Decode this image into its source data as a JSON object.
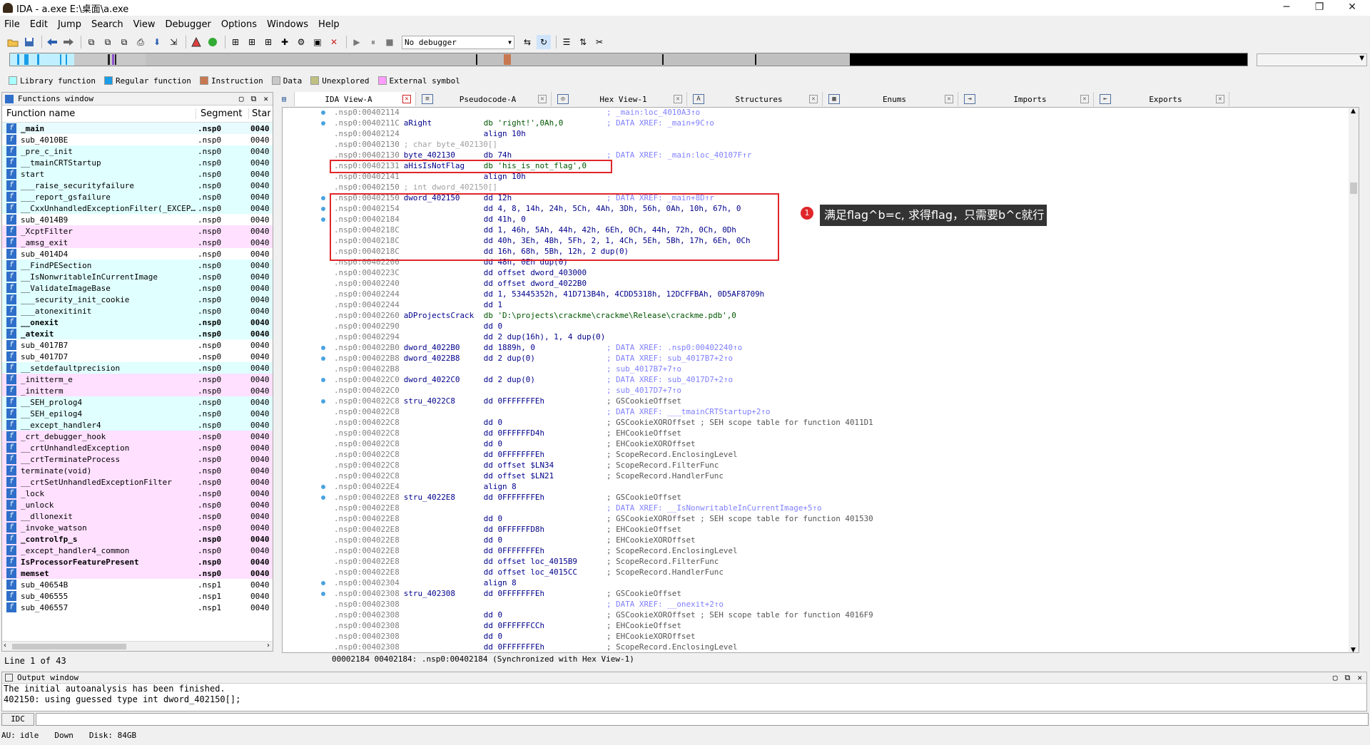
{
  "window": {
    "title": "IDA - a.exe E:\\桌面\\a.exe",
    "min": "─",
    "max": "❐",
    "close": "✕"
  },
  "menu": [
    "File",
    "Edit",
    "Jump",
    "Search",
    "View",
    "Debugger",
    "Options",
    "Windows",
    "Help"
  ],
  "toolbar": {
    "debugger_select": "No debugger"
  },
  "legend": [
    {
      "label": "Library function",
      "color": "#a8ffff"
    },
    {
      "label": "Regular function",
      "color": "#1a9ce6"
    },
    {
      "label": "Instruction",
      "color": "#c87850"
    },
    {
      "label": "Data",
      "color": "#c8c8c8"
    },
    {
      "label": "Unexplored",
      "color": "#c0c080"
    },
    {
      "label": "External symbol",
      "color": "#ff9cff"
    }
  ],
  "functions_window": {
    "title": "Functions window",
    "col_name": "Function name",
    "col_segment": "Segment",
    "col_start": "Star",
    "rows": [
      {
        "name": "_main",
        "seg": ".nsp0",
        "start": "0040",
        "bold": true,
        "bg": "#e8fbff"
      },
      {
        "name": "sub_4010BE",
        "seg": ".nsp0",
        "start": "0040",
        "bold": false,
        "bg": "#ffffff"
      },
      {
        "name": "_pre_c_init",
        "seg": ".nsp0",
        "start": "0040",
        "bold": false,
        "bg": "#e0ffff"
      },
      {
        "name": "__tmainCRTStartup",
        "seg": ".nsp0",
        "start": "0040",
        "bold": false,
        "bg": "#e0ffff"
      },
      {
        "name": "start",
        "seg": ".nsp0",
        "start": "0040",
        "bold": false,
        "bg": "#e0ffff"
      },
      {
        "name": "___raise_securityfailure",
        "seg": ".nsp0",
        "start": "0040",
        "bold": false,
        "bg": "#e0ffff"
      },
      {
        "name": "___report_gsfailure",
        "seg": ".nsp0",
        "start": "0040",
        "bold": false,
        "bg": "#e0ffff"
      },
      {
        "name": "__CxxUnhandledExceptionFilter(_EXCEPTI…",
        "seg": ".nsp0",
        "start": "0040",
        "bold": false,
        "bg": "#e0ffff"
      },
      {
        "name": "sub_4014B9",
        "seg": ".nsp0",
        "start": "0040",
        "bold": false,
        "bg": "#ffffff"
      },
      {
        "name": "_XcptFilter",
        "seg": ".nsp0",
        "start": "0040",
        "bold": false,
        "bg": "#ffe0ff"
      },
      {
        "name": "_amsg_exit",
        "seg": ".nsp0",
        "start": "0040",
        "bold": false,
        "bg": "#ffe0ff"
      },
      {
        "name": "sub_4014D4",
        "seg": ".nsp0",
        "start": "0040",
        "bold": false,
        "bg": "#ffffff"
      },
      {
        "name": "__FindPESection",
        "seg": ".nsp0",
        "start": "0040",
        "bold": false,
        "bg": "#e0ffff"
      },
      {
        "name": "__IsNonwritableInCurrentImage",
        "seg": ".nsp0",
        "start": "0040",
        "bold": false,
        "bg": "#e0ffff"
      },
      {
        "name": "__ValidateImageBase",
        "seg": ".nsp0",
        "start": "0040",
        "bold": false,
        "bg": "#e0ffff"
      },
      {
        "name": "___security_init_cookie",
        "seg": ".nsp0",
        "start": "0040",
        "bold": false,
        "bg": "#e0ffff"
      },
      {
        "name": "___atonexitinit",
        "seg": ".nsp0",
        "start": "0040",
        "bold": false,
        "bg": "#e0ffff"
      },
      {
        "name": "__onexit",
        "seg": ".nsp0",
        "start": "0040",
        "bold": true,
        "bg": "#e0ffff"
      },
      {
        "name": "_atexit",
        "seg": ".nsp0",
        "start": "0040",
        "bold": true,
        "bg": "#e0ffff"
      },
      {
        "name": "sub_4017B7",
        "seg": ".nsp0",
        "start": "0040",
        "bold": false,
        "bg": "#ffffff"
      },
      {
        "name": "sub_4017D7",
        "seg": ".nsp0",
        "start": "0040",
        "bold": false,
        "bg": "#ffffff"
      },
      {
        "name": "__setdefaultprecision",
        "seg": ".nsp0",
        "start": "0040",
        "bold": false,
        "bg": "#e0ffff"
      },
      {
        "name": "_initterm_e",
        "seg": ".nsp0",
        "start": "0040",
        "bold": false,
        "bg": "#ffe0ff"
      },
      {
        "name": "_initterm",
        "seg": ".nsp0",
        "start": "0040",
        "bold": false,
        "bg": "#ffe0ff"
      },
      {
        "name": "__SEH_prolog4",
        "seg": ".nsp0",
        "start": "0040",
        "bold": false,
        "bg": "#e0ffff"
      },
      {
        "name": "__SEH_epilog4",
        "seg": ".nsp0",
        "start": "0040",
        "bold": false,
        "bg": "#e0ffff"
      },
      {
        "name": "__except_handler4",
        "seg": ".nsp0",
        "start": "0040",
        "bold": false,
        "bg": "#e0ffff"
      },
      {
        "name": "_crt_debugger_hook",
        "seg": ".nsp0",
        "start": "0040",
        "bold": false,
        "bg": "#ffe0ff"
      },
      {
        "name": "__crtUnhandledException",
        "seg": ".nsp0",
        "start": "0040",
        "bold": false,
        "bg": "#ffe0ff"
      },
      {
        "name": "__crtTerminateProcess",
        "seg": ".nsp0",
        "start": "0040",
        "bold": false,
        "bg": "#ffe0ff"
      },
      {
        "name": "terminate(void)",
        "seg": ".nsp0",
        "start": "0040",
        "bold": false,
        "bg": "#ffe0ff"
      },
      {
        "name": "__crtSetUnhandledExceptionFilter",
        "seg": ".nsp0",
        "start": "0040",
        "bold": false,
        "bg": "#ffe0ff"
      },
      {
        "name": "_lock",
        "seg": ".nsp0",
        "start": "0040",
        "bold": false,
        "bg": "#ffe0ff"
      },
      {
        "name": "_unlock",
        "seg": ".nsp0",
        "start": "0040",
        "bold": false,
        "bg": "#ffe0ff"
      },
      {
        "name": "__dllonexit",
        "seg": ".nsp0",
        "start": "0040",
        "bold": false,
        "bg": "#ffe0ff"
      },
      {
        "name": "_invoke_watson",
        "seg": ".nsp0",
        "start": "0040",
        "bold": false,
        "bg": "#ffe0ff"
      },
      {
        "name": "_controlfp_s",
        "seg": ".nsp0",
        "start": "0040",
        "bold": true,
        "bg": "#ffe0ff"
      },
      {
        "name": "_except_handler4_common",
        "seg": ".nsp0",
        "start": "0040",
        "bold": false,
        "bg": "#ffe0ff"
      },
      {
        "name": "IsProcessorFeaturePresent",
        "seg": ".nsp0",
        "start": "0040",
        "bold": true,
        "bg": "#ffe0ff"
      },
      {
        "name": "memset",
        "seg": ".nsp0",
        "start": "0040",
        "bold": true,
        "bg": "#ffe0ff"
      },
      {
        "name": "sub_40654B",
        "seg": ".nsp1",
        "start": "0040",
        "bold": false,
        "bg": "#ffffff"
      },
      {
        "name": "sub_406555",
        "seg": ".nsp1",
        "start": "0040",
        "bold": false,
        "bg": "#ffffff"
      },
      {
        "name": "sub_406557",
        "seg": ".nsp1",
        "start": "0040",
        "bold": false,
        "bg": "#ffffff"
      }
    ],
    "status": "Line 1 of 43"
  },
  "tabs": [
    {
      "label": "IDA View-A",
      "icon": "ida-view-icon",
      "active": true
    },
    {
      "label": "Pseudocode-A",
      "icon": "pseudocode-icon",
      "active": false
    },
    {
      "label": "Hex View-1",
      "icon": "hex-view-icon",
      "active": false
    },
    {
      "label": "Structures",
      "icon": "structures-icon",
      "active": false
    },
    {
      "label": "Enums",
      "icon": "enums-icon",
      "active": false
    },
    {
      "label": "Imports",
      "icon": "imports-icon",
      "active": false
    },
    {
      "label": "Exports",
      "icon": "exports-icon",
      "active": false
    }
  ],
  "disasm": [
    {
      "a": ".nsp0:00402114",
      "n": "",
      "o": "",
      "c": "; _main:loc_4010A3↑o",
      "dot": true
    },
    {
      "a": ".nsp0:0040211C",
      "n": "aRight",
      "o": "db 'right!',0Ah,0",
      "c": "; DATA XREF: _main+9C↑o",
      "dot": true
    },
    {
      "a": ".nsp0:00402124",
      "n": "",
      "o": "align 10h",
      "c": "",
      "dot": false
    },
    {
      "a": ".nsp0:00402130",
      "n": "; char byte_402130[]",
      "o": "",
      "c": "",
      "dot": false
    },
    {
      "a": ".nsp0:00402130",
      "n": "byte_402130",
      "o": "db 74h",
      "c": "; DATA XREF: _main:loc_40107F↑r",
      "dot": false
    },
    {
      "a": ".nsp0:00402131",
      "n": "aHisIsNotFlag",
      "o": "db 'his_is_not_flag',0",
      "c": "",
      "dot": false
    },
    {
      "a": ".nsp0:00402141",
      "n": "",
      "o": "align 10h",
      "c": "",
      "dot": false
    },
    {
      "a": ".nsp0:00402150",
      "n": "; int dword_402150[]",
      "o": "",
      "c": "",
      "dot": false
    },
    {
      "a": ".nsp0:00402150",
      "n": "dword_402150",
      "o": "dd 12h",
      "c": "; DATA XREF: _main+8D↑r",
      "dot": true
    },
    {
      "a": ".nsp0:00402154",
      "n": "",
      "o": "dd 4, 8, 14h, 24h, 5Ch, 4Ah, 3Dh, 56h, 0Ah, 10h, 67h, 0",
      "c": "",
      "dot": true
    },
    {
      "a": ".nsp0:00402184",
      "n": "",
      "o": "dd 41h, 0",
      "c": "",
      "dot": true
    },
    {
      "a": ".nsp0:0040218C",
      "n": "",
      "o": "dd 1, 46h, 5Ah, 44h, 42h, 6Eh, 0Ch, 44h, 72h, 0Ch, 0Dh",
      "c": "",
      "dot": false
    },
    {
      "a": ".nsp0:0040218C",
      "n": "",
      "o": "dd 40h, 3Eh, 4Bh, 5Fh, 2, 1, 4Ch, 5Eh, 5Bh, 17h, 6Eh, 0Ch",
      "c": "",
      "dot": false
    },
    {
      "a": ".nsp0:0040218C",
      "n": "",
      "o": "dd 16h, 68h, 5Bh, 12h, 2 dup(0)",
      "c": "",
      "dot": false
    },
    {
      "a": ".nsp0:00402200",
      "n": "",
      "o": "dd 48h, 0Eh dup(0)",
      "c": "",
      "dot": false
    },
    {
      "a": ".nsp0:0040223C",
      "n": "",
      "o": "dd offset dword_403000",
      "c": "",
      "dot": false
    },
    {
      "a": ".nsp0:00402240",
      "n": "",
      "o": "dd offset dword_4022B0",
      "c": "",
      "dot": false
    },
    {
      "a": ".nsp0:00402244",
      "n": "",
      "o": "dd 1, 53445352h, 41D713B4h, 4CDD5318h, 12DCFFBAh, 0D5AF8709h",
      "c": "",
      "dot": false
    },
    {
      "a": ".nsp0:00402244",
      "n": "",
      "o": "dd 1",
      "c": "",
      "dot": false
    },
    {
      "a": ".nsp0:00402260",
      "n": "aDProjectsCrack",
      "o": "db 'D:\\projects\\crackme\\crackme\\Release\\crackme.pdb',0",
      "c": "",
      "dot": false
    },
    {
      "a": ".nsp0:00402290",
      "n": "",
      "o": "dd 0",
      "c": "",
      "dot": false
    },
    {
      "a": ".nsp0:00402294",
      "n": "",
      "o": "dd 2 dup(16h), 1, 4 dup(0)",
      "c": "",
      "dot": false
    },
    {
      "a": ".nsp0:004022B0",
      "n": "dword_4022B0",
      "o": "dd 1889h, 0",
      "c": "; DATA XREF: .nsp0:00402240↑o",
      "dot": true
    },
    {
      "a": ".nsp0:004022B8",
      "n": "dword_4022B8",
      "o": "dd 2 dup(0)",
      "c": "; DATA XREF: sub_4017B7+2↑o",
      "dot": true
    },
    {
      "a": ".nsp0:004022B8",
      "n": "",
      "o": "",
      "c": "; sub_4017B7+7↑o",
      "dot": false
    },
    {
      "a": ".nsp0:004022C0",
      "n": "dword_4022C0",
      "o": "dd 2 dup(0)",
      "c": "; DATA XREF: sub_4017D7+2↑o",
      "dot": true
    },
    {
      "a": ".nsp0:004022C0",
      "n": "",
      "o": "",
      "c": "; sub_4017D7+7↑o",
      "dot": false
    },
    {
      "a": ".nsp0:004022C8",
      "n": "stru_4022C8",
      "o": "dd 0FFFFFFFEh",
      "c": "; GSCookieOffset",
      "dot": true
    },
    {
      "a": ".nsp0:004022C8",
      "n": "",
      "o": "",
      "c": "; DATA XREF: ___tmainCRTStartup+2↑o",
      "dot": false
    },
    {
      "a": ".nsp0:004022C8",
      "n": "",
      "o": "dd 0",
      "c": "; GSCookieXOROffset ; SEH scope table for function 4011D1",
      "dot": false
    },
    {
      "a": ".nsp0:004022C8",
      "n": "",
      "o": "dd 0FFFFFFD4h",
      "c": "; EHCookieOffset",
      "dot": false
    },
    {
      "a": ".nsp0:004022C8",
      "n": "",
      "o": "dd 0",
      "c": "; EHCookieXOROffset",
      "dot": false
    },
    {
      "a": ".nsp0:004022C8",
      "n": "",
      "o": "dd 0FFFFFFFEh",
      "c": "; ScopeRecord.EnclosingLevel",
      "dot": false
    },
    {
      "a": ".nsp0:004022C8",
      "n": "",
      "o": "dd offset $LN34",
      "c": "; ScopeRecord.FilterFunc",
      "dot": false
    },
    {
      "a": ".nsp0:004022C8",
      "n": "",
      "o": "dd offset $LN21",
      "c": "; ScopeRecord.HandlerFunc",
      "dot": false
    },
    {
      "a": ".nsp0:004022E4",
      "n": "",
      "o": "align 8",
      "c": "",
      "dot": true
    },
    {
      "a": ".nsp0:004022E8",
      "n": "stru_4022E8",
      "o": "dd 0FFFFFFFEh",
      "c": "; GSCookieOffset",
      "dot": true
    },
    {
      "a": ".nsp0:004022E8",
      "n": "",
      "o": "",
      "c": "; DATA XREF: __IsNonwritableInCurrentImage+5↑o",
      "dot": false
    },
    {
      "a": ".nsp0:004022E8",
      "n": "",
      "o": "dd 0",
      "c": "; GSCookieXOROffset ; SEH scope table for function 401530",
      "dot": false
    },
    {
      "a": ".nsp0:004022E8",
      "n": "",
      "o": "dd 0FFFFFFD8h",
      "c": "; EHCookieOffset",
      "dot": false
    },
    {
      "a": ".nsp0:004022E8",
      "n": "",
      "o": "dd 0",
      "c": "; EHCookieXOROffset",
      "dot": false
    },
    {
      "a": ".nsp0:004022E8",
      "n": "",
      "o": "dd 0FFFFFFFEh",
      "c": "; ScopeRecord.EnclosingLevel",
      "dot": false
    },
    {
      "a": ".nsp0:004022E8",
      "n": "",
      "o": "dd offset loc_4015B9",
      "c": "; ScopeRecord.FilterFunc",
      "dot": false
    },
    {
      "a": ".nsp0:004022E8",
      "n": "",
      "o": "dd offset loc_4015CC",
      "c": "; ScopeRecord.HandlerFunc",
      "dot": false
    },
    {
      "a": ".nsp0:00402304",
      "n": "",
      "o": "align 8",
      "c": "",
      "dot": true
    },
    {
      "a": ".nsp0:00402308",
      "n": "stru_402308",
      "o": "dd 0FFFFFFFEh",
      "c": "; GSCookieOffset",
      "dot": true
    },
    {
      "a": ".nsp0:00402308",
      "n": "",
      "o": "",
      "c": "; DATA XREF: __onexit+2↑o",
      "dot": false
    },
    {
      "a": ".nsp0:00402308",
      "n": "",
      "o": "dd 0",
      "c": "; GSCookieXOROffset ; SEH scope table for function 4016F9",
      "dot": false
    },
    {
      "a": ".nsp0:00402308",
      "n": "",
      "o": "dd 0FFFFFFCCh",
      "c": "; EHCookieOffset",
      "dot": false
    },
    {
      "a": ".nsp0:00402308",
      "n": "",
      "o": "dd 0",
      "c": "; EHCookieXOROffset",
      "dot": false
    },
    {
      "a": ".nsp0:00402308",
      "n": "",
      "o": "dd 0FFFFFFFEh",
      "c": "; ScopeRecord.EnclosingLevel",
      "dot": false
    }
  ],
  "ida_status": "00002184 00402184: .nsp0:00402184 (Synchronized with Hex View-1)",
  "annotation": {
    "badge": "1",
    "text": "满足flag^b=c, 求得flag，只需要b^c就行"
  },
  "output": {
    "title": "Output window",
    "lines": [
      "The initial autoanalysis has been finished.",
      "402150: using guessed type int dword_402150[];"
    ]
  },
  "idc_label": "IDC",
  "statusbar": {
    "au": "AU:",
    "state": "idle",
    "dir": "Down",
    "disk": "Disk: 84GB"
  }
}
